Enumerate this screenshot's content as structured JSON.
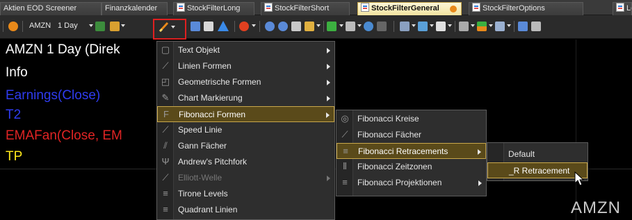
{
  "tabs": [
    {
      "label": "Aktien EOD Screener",
      "active": false,
      "icon": false
    },
    {
      "label": "Finanzkalender",
      "active": false,
      "icon": false
    },
    {
      "label": "StockFilterLong",
      "active": false,
      "icon": true
    },
    {
      "label": "StockFilterShort",
      "active": false,
      "icon": true
    },
    {
      "label": "StockFilterGeneral",
      "active": true,
      "icon": true
    },
    {
      "label": "StockFilterOptions",
      "active": false,
      "icon": true
    },
    {
      "label": "Lo",
      "active": false,
      "icon": true
    }
  ],
  "toolbar": {
    "symbol": "AMZN",
    "interval": "1 Day"
  },
  "chart": {
    "lines": [
      {
        "text": "AMZN 1 Day (Direk",
        "color": "#ffffff"
      },
      {
        "text": "Info",
        "color": "#ffffff"
      },
      {
        "text": "Earnings(Close)",
        "color": "#2f3cf0"
      },
      {
        "text": "T2",
        "color": "#2f3cf0"
      },
      {
        "text": "EMAFan(Close, EM",
        "color": "#e02424"
      },
      {
        "text": "TP",
        "color": "#ffe81a"
      }
    ],
    "watermark": "AMZN"
  },
  "menu1": {
    "items": [
      {
        "label": "Text Objekt",
        "icon": "text-object-icon",
        "glyph": "▢",
        "submenu": true,
        "disabled": false,
        "highlighted": false
      },
      {
        "label": "Linien Formen",
        "icon": "line-shapes-icon",
        "glyph": "⟋",
        "submenu": true,
        "disabled": false,
        "highlighted": false
      },
      {
        "label": "Geometrische Formen",
        "icon": "geometric-shapes-icon",
        "glyph": "◰",
        "submenu": true,
        "disabled": false,
        "highlighted": false
      },
      {
        "label": "Chart Markierung",
        "icon": "chart-marker-icon",
        "glyph": "✎",
        "submenu": true,
        "disabled": false,
        "highlighted": false
      },
      {
        "label": "Fibonacci Formen",
        "icon": "fibonacci-shapes-icon",
        "glyph": "F",
        "submenu": true,
        "disabled": false,
        "highlighted": true
      },
      {
        "label": "Speed Linie",
        "icon": "speed-line-icon",
        "glyph": "⟋",
        "submenu": false,
        "disabled": false,
        "highlighted": false
      },
      {
        "label": "Gann Fächer",
        "icon": "gann-fan-icon",
        "glyph": "⫽",
        "submenu": false,
        "disabled": false,
        "highlighted": false
      },
      {
        "label": "Andrew's Pitchfork",
        "icon": "pitchfork-icon",
        "glyph": "Ψ",
        "submenu": false,
        "disabled": false,
        "highlighted": false
      },
      {
        "label": "Elliott-Welle",
        "icon": "elliott-wave-icon",
        "glyph": "⟋",
        "submenu": true,
        "disabled": true,
        "highlighted": false
      },
      {
        "label": "Tirone Levels",
        "icon": "tirone-levels-icon",
        "glyph": "≡",
        "submenu": false,
        "disabled": false,
        "highlighted": false
      },
      {
        "label": "Quadrant Linien",
        "icon": "quadrant-lines-icon",
        "glyph": "≡",
        "submenu": false,
        "disabled": false,
        "highlighted": false
      }
    ]
  },
  "menu2": {
    "items": [
      {
        "label": "Fibonacci Kreise",
        "icon": "fibonacci-circles-icon",
        "glyph": "◎",
        "submenu": false,
        "highlighted": false
      },
      {
        "label": "Fibonacci Fächer",
        "icon": "fibonacci-fan-icon",
        "glyph": "⟋",
        "submenu": false,
        "highlighted": false
      },
      {
        "label": "Fibonacci Retracements",
        "icon": "fibonacci-retracements-icon",
        "glyph": "≡",
        "submenu": true,
        "highlighted": true
      },
      {
        "label": "Fibonacci Zeitzonen",
        "icon": "fibonacci-timezones-icon",
        "glyph": "⦀",
        "submenu": false,
        "highlighted": false
      },
      {
        "label": "Fibonacci Projektionen",
        "icon": "fibonacci-projections-icon",
        "glyph": "≡",
        "submenu": true,
        "highlighted": false
      }
    ]
  },
  "menu3": {
    "items": [
      {
        "label": "Default",
        "highlighted": false
      },
      {
        "label": "_R Retracement",
        "highlighted": true
      }
    ]
  }
}
